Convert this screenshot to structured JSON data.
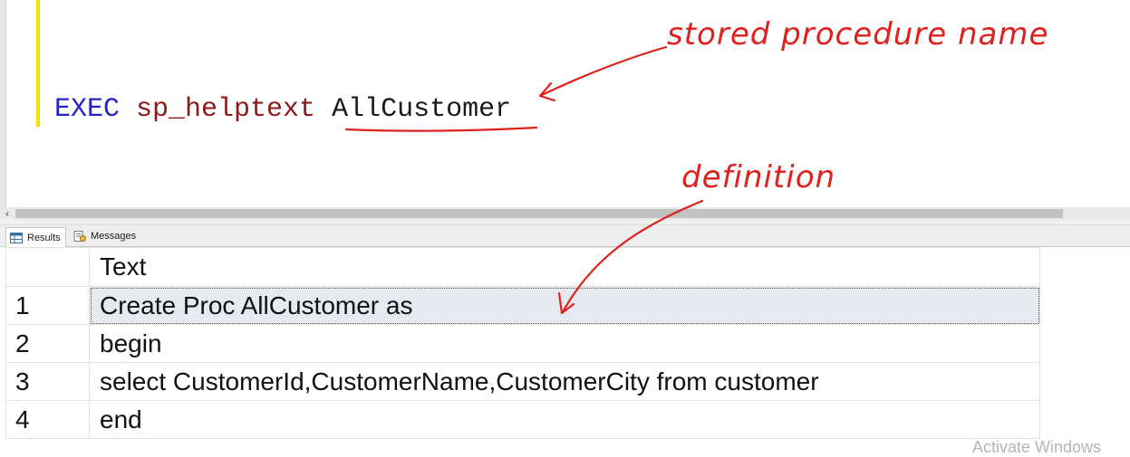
{
  "editor": {
    "code": {
      "keyword": "EXEC",
      "procedure": "sp_helptext",
      "argument": "AllCustomer"
    }
  },
  "tabs": [
    {
      "label": "Results",
      "icon": "grid-icon",
      "active": true
    },
    {
      "label": "Messages",
      "icon": "messages-icon",
      "active": false
    }
  ],
  "results": {
    "columns": [
      "",
      "Text"
    ],
    "rows": [
      {
        "num": "1",
        "text": "Create Proc AllCustomer  as",
        "selected": true
      },
      {
        "num": "2",
        "text": "begin"
      },
      {
        "num": "3",
        "text": "select CustomerId,CustomerName,CustomerCity from customer"
      },
      {
        "num": "4",
        "text": "end"
      }
    ]
  },
  "annotations": {
    "proc_name_label": "stored procedure name",
    "definition_label": "definition",
    "color": "#e0201a"
  },
  "watermark": "Activate Windows",
  "colors": {
    "keyword": "#2323c8",
    "procedure": "#8b1a1a",
    "change_bar": "#f2e200",
    "selection": "#e5eaf0"
  }
}
